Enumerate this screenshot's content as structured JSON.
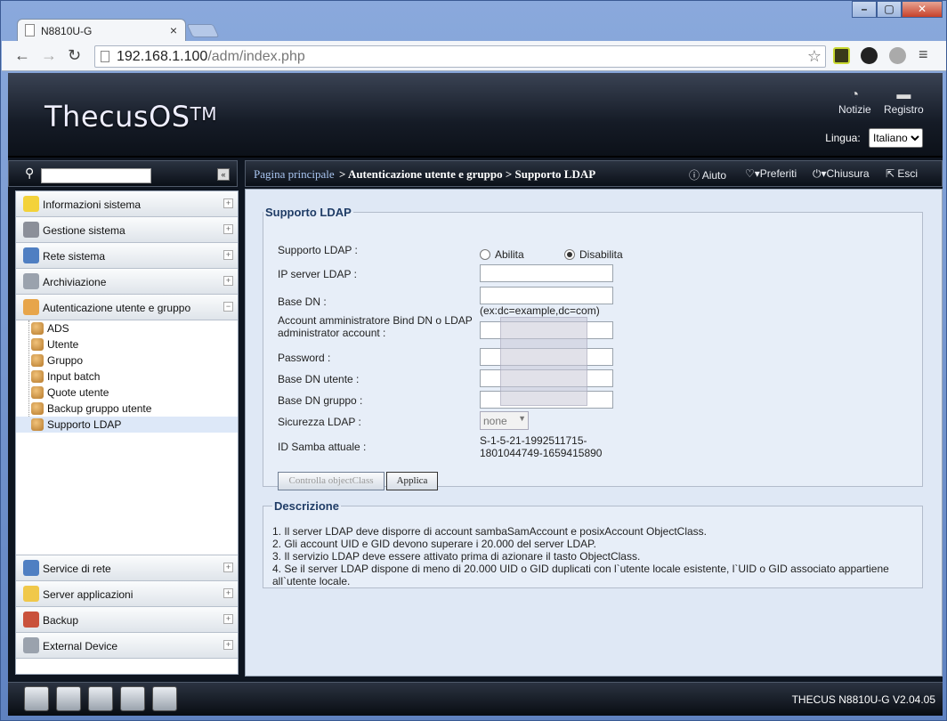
{
  "browser": {
    "tab_title": "N8810U-G",
    "url_host": "192.168.1.100",
    "url_path": "/adm/index.php"
  },
  "header": {
    "logo": "ThecusOS",
    "logo_tm": "TM",
    "notizie": "Notizie",
    "registro": "Registro",
    "lingua_label": "Lingua:",
    "lingua_value": "Italiano"
  },
  "menu": {
    "groups_top": [
      "Informazioni sistema",
      "Gestione sistema",
      "Rete sistema",
      "Archiviazione",
      "Autenticazione utente e gruppo"
    ],
    "sub_items": [
      "ADS",
      "Utente",
      "Gruppo",
      "Input batch",
      "Quote utente",
      "Backup gruppo utente",
      "Supporto LDAP"
    ],
    "groups_bottom": [
      "Service di rete",
      "Server applicazioni",
      "Backup",
      "External Device"
    ]
  },
  "breadcrumb": {
    "home": "Pagina principale",
    "path": "> Autenticazione utente e gruppo > Supporto LDAP",
    "aiuto": "Aiuto",
    "preferiti": "Preferiti",
    "chiusura": "Chiusura",
    "esci": "Esci"
  },
  "form": {
    "legend": "Supporto LDAP",
    "support_label": "Supporto LDAP :",
    "enable": "Abilita",
    "disable": "Disabilita",
    "ip_label": "IP server LDAP :",
    "base_dn_label": "Base DN :",
    "base_dn_hint": "(ex:dc=example,dc=com)",
    "bind_label": "Account amministratore Bind DN o LDAP administrator account :",
    "password_label": "Password :",
    "base_dn_user_label": "Base DN utente :",
    "base_dn_group_label": "Base DN gruppo :",
    "security_label": "Sicurezza LDAP :",
    "security_value": "none",
    "samba_label": "ID Samba attuale :",
    "samba_value": "S-1-5-21-1992511715-1801044749-1659415890",
    "check_button": "Controlla objectClass",
    "apply_button": "Applica"
  },
  "description": {
    "legend": "Descrizione",
    "lines": [
      "1. Il server LDAP deve disporre di account sambaSamAccount e posixAccount ObjectClass.",
      "2. Gli account UID e GID devono superare i 20.000 del server LDAP.",
      "3. Il servizio LDAP deve essere attivato prima di azionare il tasto ObjectClass.",
      "4. Se il server LDAP dispone di meno di 20.000 UID o GID duplicati con l`utente locale esistente, l`UID o GID associato appartiene all`utente locale."
    ]
  },
  "footer": {
    "version": "THECUS N8810U-G V2.04.05"
  }
}
